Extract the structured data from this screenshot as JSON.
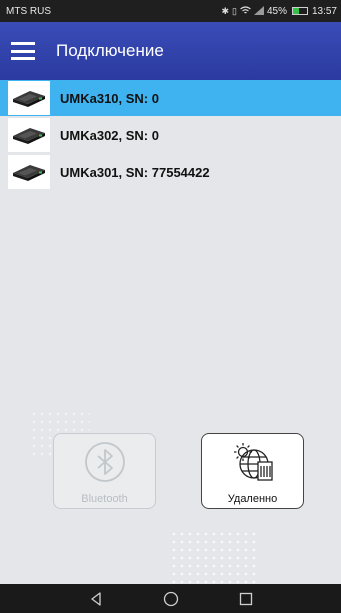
{
  "status_bar": {
    "carrier": "MTS RUS",
    "icons": [
      "bluetooth-icon",
      "vibrate-icon",
      "wifi-icon",
      "signal-icon"
    ],
    "battery_percent": "45%",
    "battery_level": 0.45,
    "time": "13:57"
  },
  "app_bar": {
    "menu_icon": "hamburger-menu-icon",
    "title": "Подключение",
    "color": "#3446b0"
  },
  "devices": [
    {
      "label": "UMKa310, SN: 0",
      "selected": true
    },
    {
      "label": "UMKa302, SN: 0",
      "selected": false
    },
    {
      "label": "UMKa301, SN: 77554422",
      "selected": false
    }
  ],
  "selection_color": "#3fb3f0",
  "buttons": {
    "bluetooth": {
      "label": "Bluetooth",
      "icon": "bluetooth-icon",
      "enabled": false
    },
    "remote": {
      "label": "Удаленно",
      "icon": "remote-connection-icon",
      "enabled": true
    }
  },
  "nav_bar": {
    "back": "back-triangle-icon",
    "home": "home-circle-icon",
    "recents": "recents-square-icon"
  }
}
